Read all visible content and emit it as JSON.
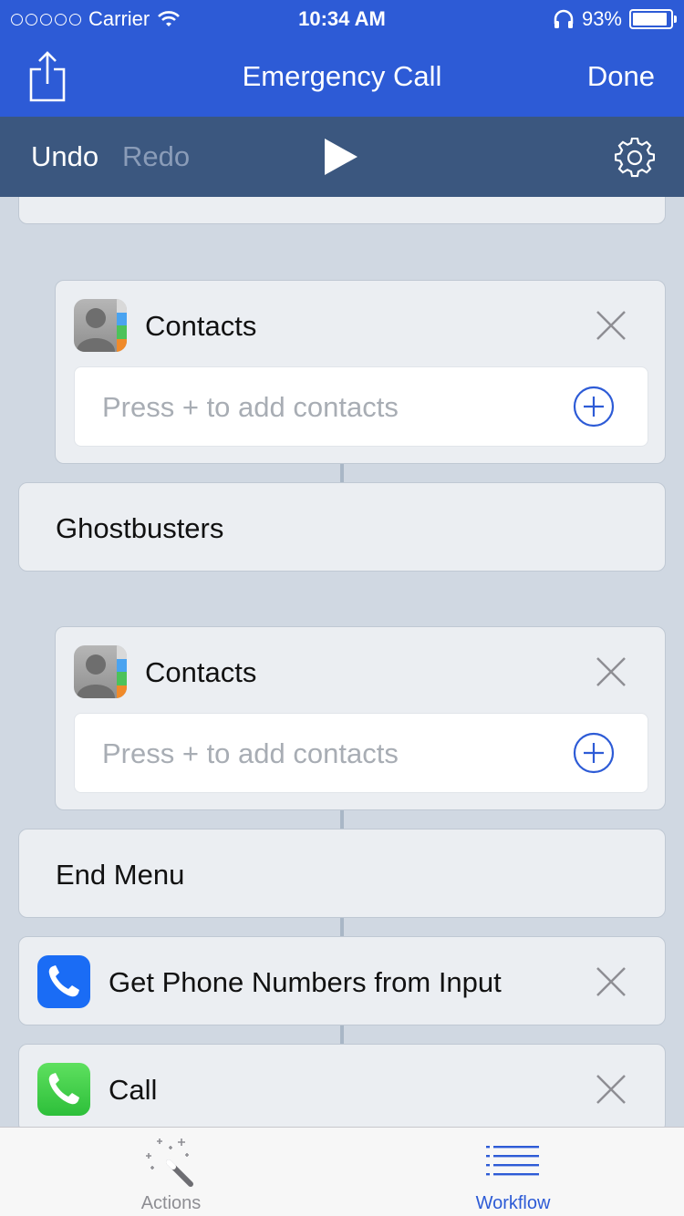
{
  "status_bar": {
    "carrier": "Carrier",
    "time": "10:34 AM",
    "battery_percent": "93%",
    "battery_level": 0.93
  },
  "nav": {
    "title": "Emergency Call",
    "done_label": "Done",
    "share_icon": "share-icon"
  },
  "toolbar": {
    "undo_label": "Undo",
    "redo_label": "Redo",
    "play_icon": "play-icon",
    "settings_icon": "gear-icon"
  },
  "workflow": {
    "contacts_1": {
      "title": "Contacts",
      "placeholder": "Press + to add contacts"
    },
    "menu_item": {
      "label": "Ghostbusters"
    },
    "contacts_2": {
      "title": "Contacts",
      "placeholder": "Press + to add contacts"
    },
    "end_menu": {
      "label": "End Menu"
    },
    "get_phone": {
      "title": "Get Phone Numbers from Input"
    },
    "call": {
      "title": "Call"
    }
  },
  "tabbar": {
    "actions_label": "Actions",
    "workflow_label": "Workflow",
    "active_tab": "Workflow"
  },
  "colors": {
    "nav_bg": "#2d5bd6",
    "toolbar_bg": "#3b577f",
    "accent": "#2d5bd6",
    "canvas_bg": "#d0d8e2",
    "card_bg": "#ebeef2",
    "phone_blue": "#1a6cf5",
    "phone_green": "#3fd14d"
  }
}
